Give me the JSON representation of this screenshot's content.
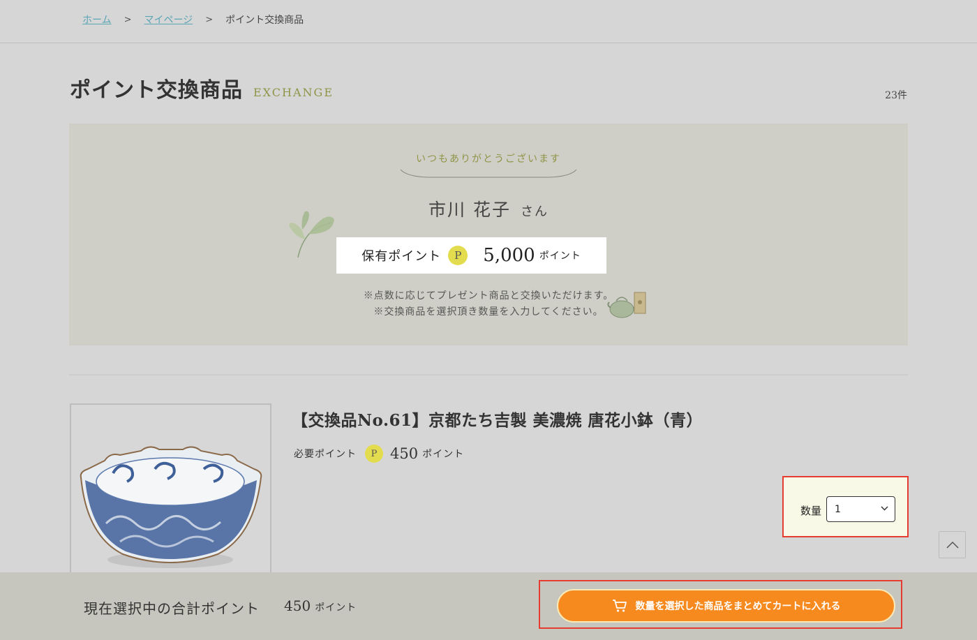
{
  "breadcrumb": {
    "home": "ホーム",
    "mypage": "マイページ",
    "current": "ポイント交換商品",
    "separator": ">"
  },
  "page": {
    "title": "ポイント交換商品",
    "subtitle": "EXCHANGE",
    "count": "23件"
  },
  "points_panel": {
    "thanks": "いつもありがとうございます",
    "user_name": "市川 花子",
    "honorific": "さん",
    "holding_label": "保有ポイント",
    "coin": "P",
    "holding_amount": "5,000",
    "unit": "ポイント",
    "notice_line1": "※点数に応じてプレゼント商品と交換いただけます。",
    "notice_line2": "※交換商品を選択頂き数量を入力してください。",
    "leaf_icon": "tea-leaf-icon",
    "teapot_icon": "teapot-icon"
  },
  "product": {
    "name": "【交換品No.61】京都たち吉製 美濃焼 唐花小鉢（青）",
    "required_label": "必要ポイント",
    "coin": "P",
    "required_amount": "450",
    "unit": "ポイント",
    "image_icon": "blue-bowl-image"
  },
  "quantity": {
    "label": "数量",
    "value": "1"
  },
  "bottom_bar": {
    "total_label": "現在選択中の合計ポイント",
    "total_amount": "450",
    "unit": "ポイント",
    "cart_button": "数量を選択した商品をまとめてカートに入れる"
  },
  "colors": {
    "accent_orange": "#f78a1f",
    "highlight_red": "#e53c32",
    "olive": "#8f9447",
    "coin_yellow": "#e3dc4e",
    "link_teal": "#5aa6b4"
  }
}
